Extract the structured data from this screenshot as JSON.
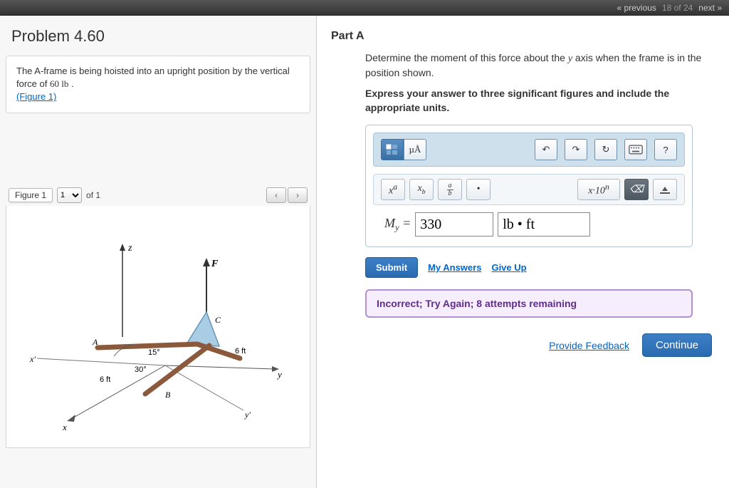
{
  "topbar": {
    "prev": "« previous",
    "count": "18 of 24",
    "next": "next »"
  },
  "problem": {
    "title": "Problem 4.60",
    "text_prefix": "The A-frame is being hoisted into an upright position by the vertical force of ",
    "force_value": "60 lb",
    "text_suffix": " .",
    "figure_link": "(Figure 1)"
  },
  "figure": {
    "label": "Figure 1",
    "selected": "1",
    "of_text": "of 1",
    "prev_glyph": "‹",
    "next_glyph": "›",
    "annot": {
      "z": "z",
      "F": "F",
      "C": "C",
      "A": "A",
      "B": "B",
      "angle15": "15°",
      "angle30": "30°",
      "len6a": "6 ft",
      "len6b": "6 ft",
      "xprime": "x′",
      "yprime": "y′",
      "x": "x",
      "y": "y"
    }
  },
  "partA": {
    "title": "Part A",
    "desc": "Determine the moment of this force about the y axis when the frame is in the position shown.",
    "instr": "Express your answer to three significant figures and include the appropriate units.",
    "toolbar": {
      "templates_icon": "templates-icon",
      "mu_label": "µÅ",
      "undo": "↶",
      "redo": "↷",
      "reset": "↻",
      "keyboard": "⌨",
      "help": "?"
    },
    "input_tools": {
      "sup": "xᵃ",
      "sub": "xᵦ",
      "frac_top": "a",
      "frac_bot": "b",
      "dot": "•",
      "sci": "x·10ⁿ",
      "backspace": "⌫",
      "special": "▴"
    },
    "answer_label": "Mᵧ = ",
    "answer_value": "330",
    "unit_value": "lb • ft",
    "submit": "Submit",
    "my_answers": "My Answers",
    "give_up": "Give Up",
    "feedback": "Incorrect; Try Again; 8 attempts remaining"
  },
  "bottom": {
    "provide": "Provide Feedback",
    "continue": "Continue"
  }
}
